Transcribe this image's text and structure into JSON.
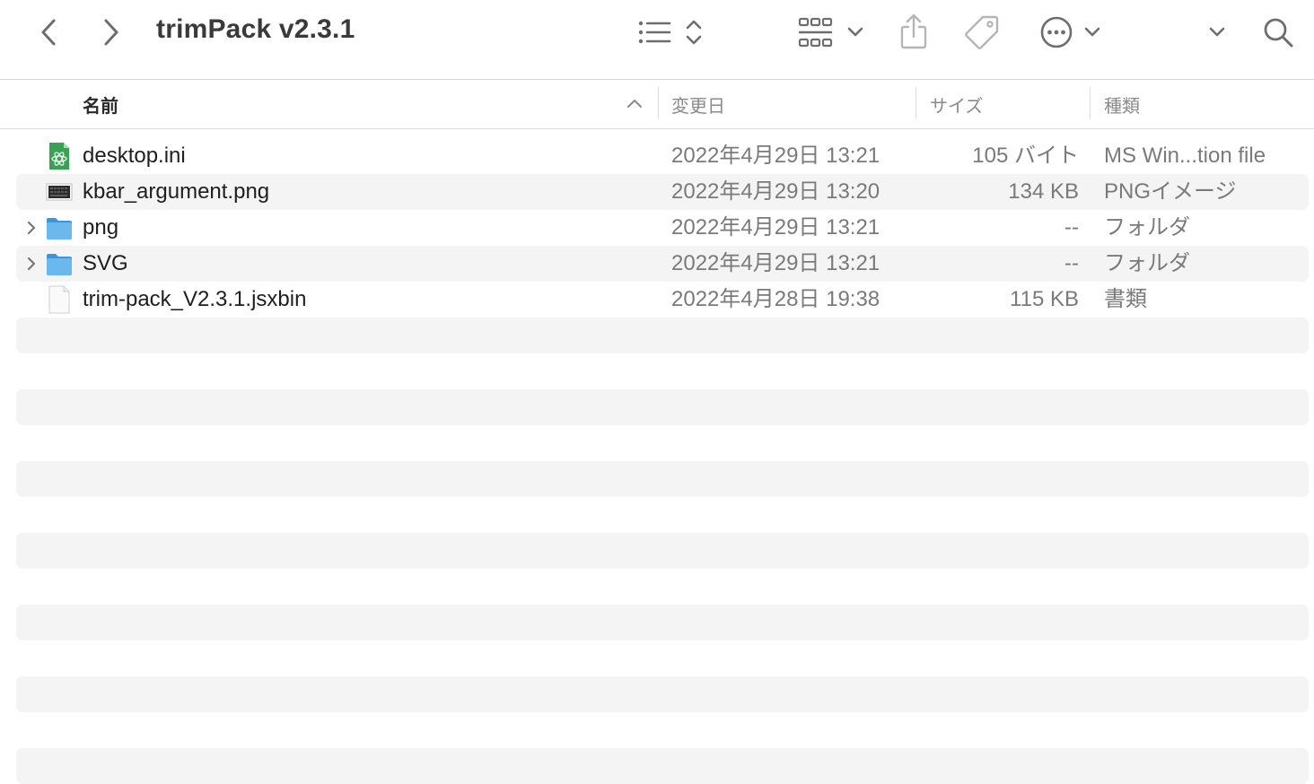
{
  "window": {
    "title": "trimPack v2.3.1"
  },
  "toolbar": {
    "icons": [
      "chevron-left-icon",
      "chevron-right-icon",
      "list-view-icon",
      "sort-updown-icon",
      "grid-view-icon",
      "chevron-down-icon",
      "share-icon",
      "tag-icon",
      "more-icon",
      "chevron-down-icon",
      "chevron-down-icon",
      "search-icon"
    ]
  },
  "columns": {
    "name": "名前",
    "date": "変更日",
    "size": "サイズ",
    "kind": "種類",
    "sort_column": "name",
    "sort_direction": "ascending"
  },
  "files": [
    {
      "name": "desktop.ini",
      "date": "2022年4月29日 13:21",
      "size": "105 バイト",
      "kind": "MS Win...tion file",
      "icon": "settings-file-icon",
      "expandable": false
    },
    {
      "name": "kbar_argument.png",
      "date": "2022年4月29日 13:20",
      "size": "134 KB",
      "kind": "PNGイメージ",
      "icon": "image-thumbnail-icon",
      "expandable": false
    },
    {
      "name": "png",
      "date": "2022年4月29日 13:21",
      "size": "--",
      "kind": "フォルダ",
      "icon": "folder-icon",
      "expandable": true
    },
    {
      "name": "SVG",
      "date": "2022年4月29日 13:21",
      "size": "--",
      "kind": "フォルダ",
      "icon": "folder-icon",
      "expandable": true
    },
    {
      "name": "trim-pack_V2.3.1.jsxbin",
      "date": "2022年4月28日 19:38",
      "size": "115 KB",
      "kind": "書類",
      "icon": "document-icon",
      "expandable": false
    }
  ],
  "colors": {
    "folder": "#5aaee8",
    "row_alt": "#f4f4f4",
    "icon_gray": "#6e6e6e"
  }
}
